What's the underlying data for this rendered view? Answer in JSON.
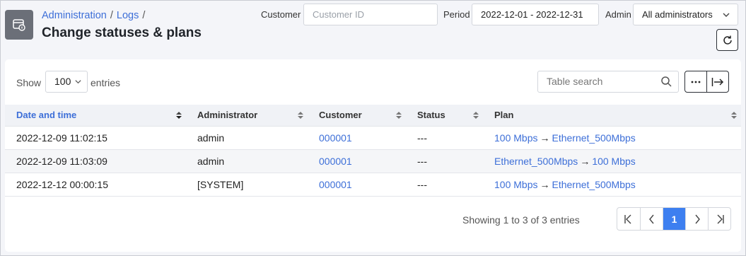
{
  "header": {
    "breadcrumb": [
      "Administration",
      "Logs"
    ],
    "breadcrumb_sep": "/",
    "title": "Change statuses & plans"
  },
  "filters": {
    "customer_label": "Customer",
    "customer_placeholder": "Customer ID",
    "period_label": "Period",
    "period_value": "2022-12-01 - 2022-12-31",
    "admin_label": "Admin",
    "admin_value": "All administrators"
  },
  "toolbar": {
    "show_label": "Show",
    "page_size": "100",
    "entries_label": "entries",
    "search_placeholder": "Table search"
  },
  "table": {
    "columns": [
      "Date and time",
      "Administrator",
      "Customer",
      "Status",
      "Plan"
    ],
    "rows": [
      {
        "datetime": "2022-12-09 11:02:15",
        "admin": "admin",
        "customer": "000001",
        "status": "---",
        "plan_from": "100 Mbps",
        "plan_to": "Ethernet_500Mbps"
      },
      {
        "datetime": "2022-12-09 11:03:09",
        "admin": "admin",
        "customer": "000001",
        "status": "---",
        "plan_from": "Ethernet_500Mbps",
        "plan_to": "100 Mbps"
      },
      {
        "datetime": "2022-12-12 00:00:15",
        "admin": "[SYSTEM]",
        "customer": "000001",
        "status": "---",
        "plan_from": "100 Mbps",
        "plan_to": "Ethernet_500Mbps"
      }
    ]
  },
  "footer": {
    "info": "Showing 1 to 3 of 3 entries",
    "current_page": "1"
  },
  "colors": {
    "link": "#3d6fd8",
    "active_page": "#3d7ff0",
    "header_bg": "#f0f2f6"
  }
}
